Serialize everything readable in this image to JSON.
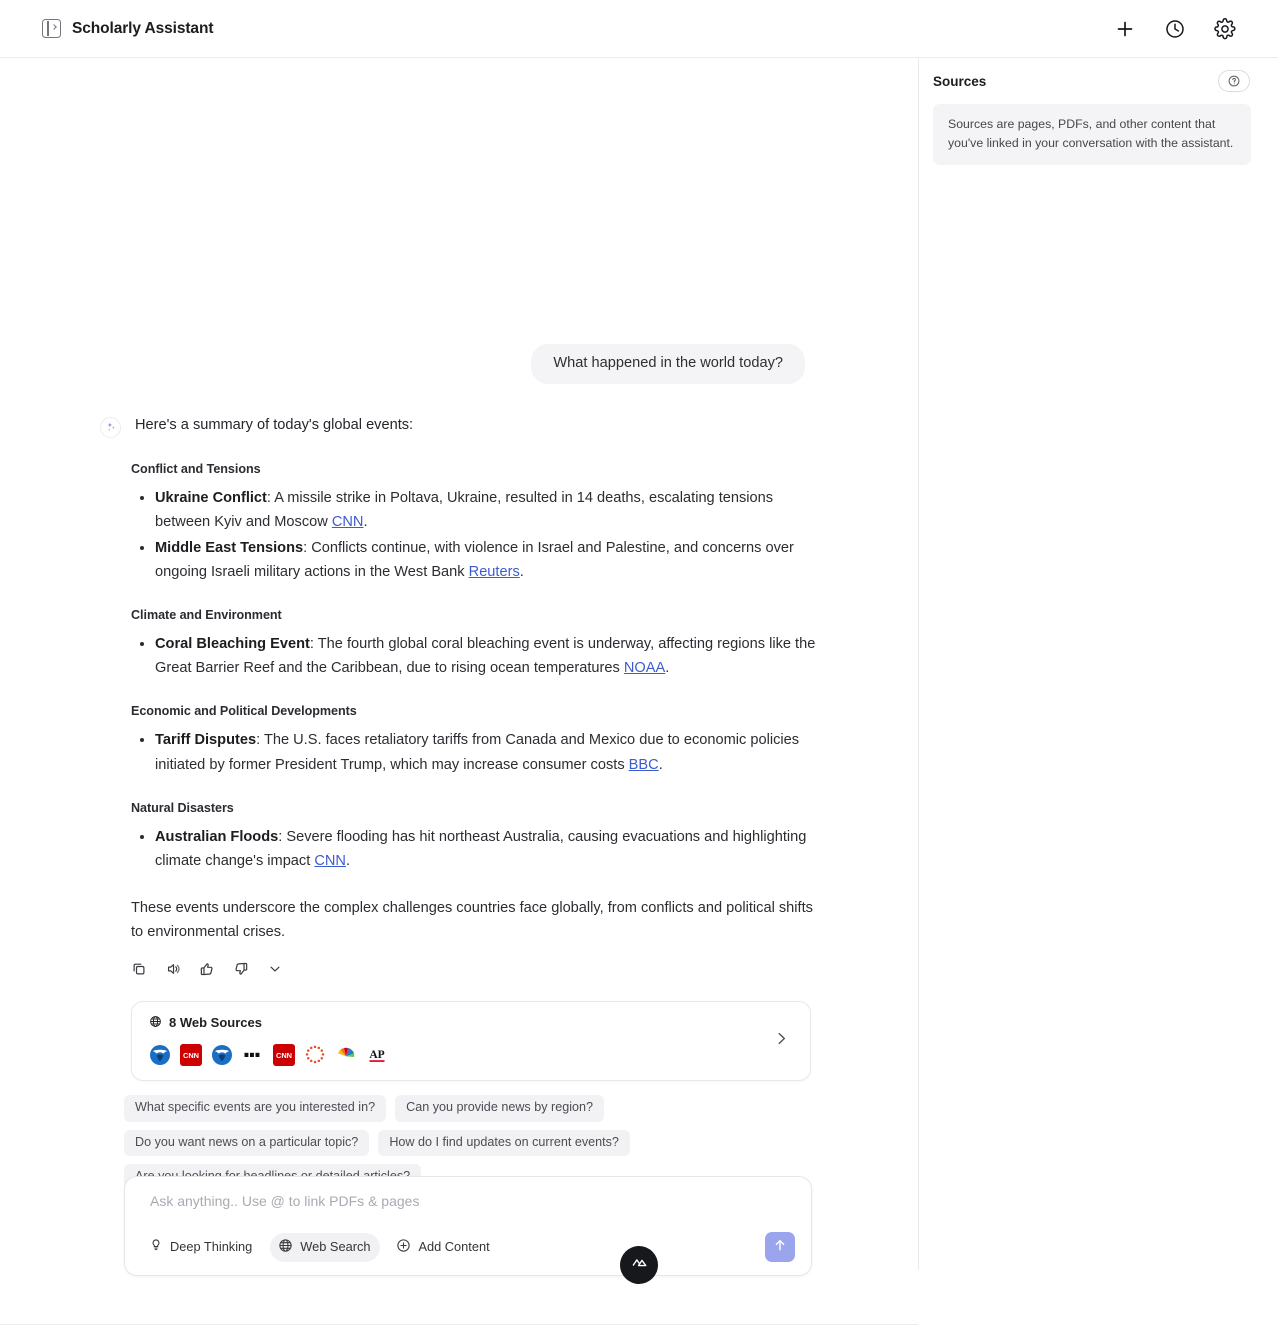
{
  "header": {
    "title": "Scholarly Assistant",
    "panel_toggle_icon": "sidebar-toggle-icon",
    "actions": [
      {
        "name": "new-chat-button",
        "icon": "plus-icon"
      },
      {
        "name": "history-button",
        "icon": "clock-icon"
      },
      {
        "name": "settings-button",
        "icon": "gear-icon"
      }
    ]
  },
  "sources_panel": {
    "title": "Sources",
    "help_icon": "question-mark-icon",
    "note": "Sources are pages, PDFs, and other content that you've linked in your conversation with the assistant."
  },
  "conversation": {
    "user_message": "What happened in the world today?",
    "assistant": {
      "avatar_icon": "sparkles-icon",
      "intro": "Here's a summary of today's global events:",
      "sections": [
        {
          "heading": "Conflict and Tensions",
          "items": [
            {
              "label": "Ukraine Conflict",
              "text_before": ": A missile strike in Poltava, Ukraine, resulted in 14 deaths, escalating tensions between Kyiv and Moscow ",
              "link": "CNN",
              "text_after": "."
            },
            {
              "label": "Middle East Tensions",
              "text_before": ": Conflicts continue, with violence in Israel and Palestine, and concerns over ongoing Israeli military actions in the West Bank ",
              "link": "Reuters",
              "text_after": "."
            }
          ]
        },
        {
          "heading": "Climate and Environment",
          "items": [
            {
              "label": "Coral Bleaching Event",
              "text_before": ": The fourth global coral bleaching event is underway, affecting regions like the Great Barrier Reef and the Caribbean, due to rising ocean temperatures ",
              "link": "NOAA",
              "text_after": "."
            }
          ]
        },
        {
          "heading": "Economic and Political Developments",
          "items": [
            {
              "label": "Tariff Disputes",
              "text_before": ": The U.S. faces retaliatory tariffs from Canada and Mexico due to economic policies initiated by former President Trump, which may increase consumer costs ",
              "link": "BBC",
              "text_after": "."
            }
          ]
        },
        {
          "heading": "Natural Disasters",
          "items": [
            {
              "label": "Australian Floods",
              "text_before": ": Severe flooding has hit northeast Australia, causing evacuations and highlighting climate change's impact ",
              "link": "CNN",
              "text_after": "."
            }
          ]
        }
      ],
      "closing": "These events underscore the complex challenges countries face globally, from conflicts and political shifts to environmental crises.",
      "actions": [
        {
          "name": "copy-button",
          "icon": "copy-icon"
        },
        {
          "name": "read-aloud-button",
          "icon": "speaker-icon"
        },
        {
          "name": "thumbs-up-button",
          "icon": "thumbs-up-icon"
        },
        {
          "name": "thumbs-down-button",
          "icon": "thumbs-down-icon"
        },
        {
          "name": "more-options-button",
          "icon": "chevron-down-icon"
        }
      ]
    }
  },
  "web_sources": {
    "icon": "globe-icon",
    "label": "8 Web Sources",
    "expand_icon": "chevron-right-icon",
    "logos": [
      {
        "name": "noaa-logo",
        "color": "#1f6fc4"
      },
      {
        "name": "cnn-logo",
        "color": "#cc0000"
      },
      {
        "name": "noaa-logo",
        "color": "#1f6fc4"
      },
      {
        "name": "bbc-logo",
        "color": "#000000"
      },
      {
        "name": "cnn-logo",
        "color": "#cc0000"
      },
      {
        "name": "reuters-logo",
        "color": "#e8502a"
      },
      {
        "name": "nbc-news-logo",
        "color": "#f5a623"
      },
      {
        "name": "ap-news-logo",
        "color": "#e4002b"
      }
    ]
  },
  "suggestions": [
    "What specific events are you interested in?",
    "Can you provide news by region?",
    "Do you want news on a particular topic?",
    "How do I find updates on current events?",
    "Are you looking for headlines or detailed articles?"
  ],
  "composer": {
    "placeholder": "Ask anything.. Use @ to link PDFs & pages",
    "value": "",
    "tools": [
      {
        "name": "deep-thinking-toggle",
        "label": "Deep Thinking",
        "icon": "lightbulb-icon",
        "active": false
      },
      {
        "name": "web-search-toggle",
        "label": "Web Search",
        "icon": "globe-icon",
        "active": true
      },
      {
        "name": "add-content-button",
        "label": "Add Content",
        "icon": "plus-circle-icon",
        "active": false
      }
    ],
    "send_icon": "send-arrow-icon",
    "send_color": "#9aa5ee"
  },
  "floating_badge": {
    "name": "brand-badge",
    "icon": "mountain-logo-icon",
    "color": "#17181c"
  }
}
